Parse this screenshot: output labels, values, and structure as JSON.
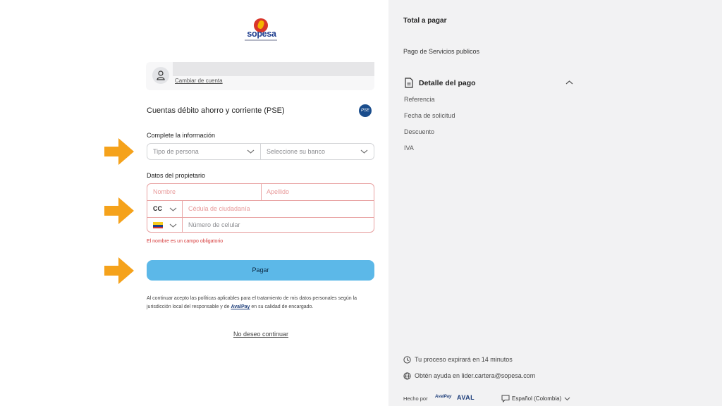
{
  "merchant": {
    "name": "sopesa"
  },
  "account": {
    "switch_label": "Cambiar de cuenta"
  },
  "payment_method": {
    "title": "Cuentas débito ahorro y corriente (PSE)",
    "icon": "pse-icon"
  },
  "form": {
    "info_heading": "Complete la información",
    "person_type_placeholder": "Tipo de persona",
    "bank_placeholder": "Seleccione su banco",
    "owner_heading": "Datos del propietario",
    "first_name_placeholder": "Nombre",
    "last_name_placeholder": "Apellido",
    "doc_type": "CC",
    "doc_number_placeholder": "Cédula de ciudadanía",
    "phone_placeholder": "Número de celular",
    "error": "El nombre es un campo obligatorio",
    "pay_label": "Pagar",
    "legal_text_1": "Al continuar acepto las políticas aplicables para el tratamiento de mis datos personales según la jurisdicción local del responsable y de ",
    "legal_link": "AvalPay",
    "legal_text_2": " en su calidad de encargado.",
    "cancel_label": "No deseo continuar"
  },
  "summary": {
    "title": "Total a pagar",
    "subtitle": "Pago de Servicios publicos",
    "detail_label": "Detalle del pago",
    "items": [
      "Referencia",
      "Fecha de solicitud",
      "Descuento",
      "IVA"
    ],
    "expiry": "Tu proceso expirará en 14 minutos",
    "help": "Obtén ayuda en lider.cartera@sopesa.com",
    "made_by": "Hecho por",
    "brand_1": "AvalPay",
    "brand_2": "AVAL",
    "language": "Español (Colombia)"
  },
  "colors": {
    "primary_button": "#5cb8e8",
    "error": "#d63a3a",
    "arrow": "#f5a21b",
    "panel": "#f2f2f3"
  }
}
